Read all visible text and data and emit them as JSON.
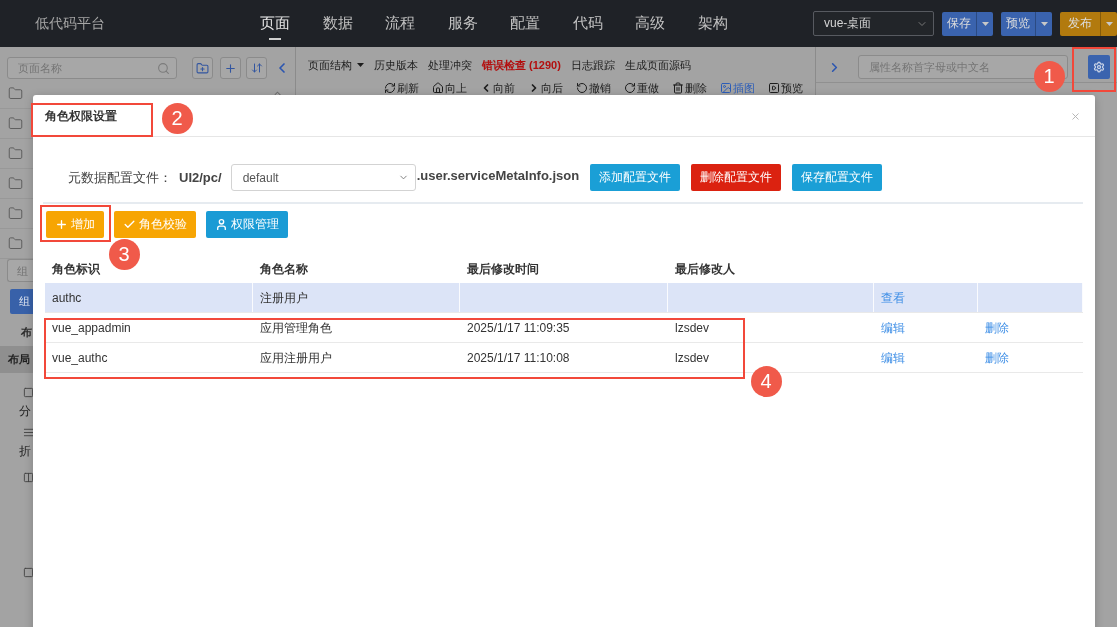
{
  "topbar": {
    "title": "低代码平台",
    "nav": [
      {
        "label": "页面",
        "selected": true
      },
      {
        "label": "数据",
        "selected": false
      },
      {
        "label": "流程",
        "selected": false
      },
      {
        "label": "服务",
        "selected": false
      },
      {
        "label": "配置",
        "selected": false
      },
      {
        "label": "代码",
        "selected": false
      },
      {
        "label": "高级",
        "selected": false
      },
      {
        "label": "架构",
        "selected": false
      }
    ],
    "project_select": {
      "value": "vue-桌面"
    },
    "buttons": [
      {
        "label": "保存",
        "kind": "primary"
      },
      {
        "label": "预览",
        "kind": "primary"
      },
      {
        "label": "发布",
        "kind": "warning"
      }
    ]
  },
  "page_panel": {
    "search": {
      "placeholder": "页面名称"
    }
  },
  "component_panel": {
    "search": {
      "placeholder": "组"
    },
    "tabs": [
      {
        "label": "组",
        "selected": true
      }
    ],
    "heading": "布",
    "category": "布局",
    "items": [
      {
        "label": "分"
      },
      {
        "label": "折"
      }
    ]
  },
  "editor_toolbar": {
    "menus": [
      {
        "label": "页面结构",
        "kind": "dropdown"
      },
      {
        "label": "历史版本",
        "kind": "plain"
      },
      {
        "label": "处理冲突",
        "kind": "plain"
      },
      {
        "label": "错误检查 (1290)",
        "kind": "error"
      },
      {
        "label": "日志跟踪",
        "kind": "plain"
      },
      {
        "label": "生成页面源码",
        "kind": "plain"
      }
    ],
    "actions": [
      {
        "label": "刷新",
        "kind": "refresh",
        "active": false
      },
      {
        "label": "向上",
        "kind": "up",
        "active": false
      },
      {
        "label": "向前",
        "kind": "back",
        "active": false
      },
      {
        "label": "向后",
        "kind": "forward",
        "active": false
      },
      {
        "label": "撤销",
        "kind": "undo",
        "active": false
      },
      {
        "label": "重做",
        "kind": "redo",
        "active": false
      },
      {
        "label": "删除",
        "kind": "delete",
        "active": false
      },
      {
        "label": "插图",
        "kind": "image",
        "active": true
      },
      {
        "label": "预览",
        "kind": "preview",
        "active": false
      }
    ]
  },
  "property_panel": {
    "search": {
      "placeholder": "属性名称首字母或中文名"
    }
  },
  "dialog": {
    "title": "角色权限设置",
    "config": {
      "label": "元数据配置文件：",
      "path_prefix": "UI2/pc/",
      "file_select": {
        "value": "default"
      },
      "suffix": ".user.serviceMetaInfo.json",
      "buttons": [
        {
          "label": "添加配置文件",
          "kind": "info"
        },
        {
          "label": "删除配置文件",
          "kind": "danger"
        },
        {
          "label": "保存配置文件",
          "kind": "info"
        }
      ]
    },
    "toolbar": [
      {
        "label": "增加",
        "kind": "add"
      },
      {
        "label": "角色校验",
        "kind": "check"
      },
      {
        "label": "权限管理",
        "kind": "permissions"
      }
    ],
    "table": {
      "columns": [
        "角色标识",
        "角色名称",
        "最后修改时间",
        "最后修改人"
      ],
      "rows": [
        {
          "role_id": "authc",
          "role_name": "注册用户",
          "selected": true,
          "actions": [
            "查看"
          ]
        },
        {
          "role_id": "vue_appadmin",
          "role_name": "应用管理角色",
          "modified_time": "2025/1/17 11:09:35",
          "modified_by": "lzsdev",
          "selected": false,
          "actions": [
            "编辑",
            "删除"
          ]
        },
        {
          "role_id": "vue_authc",
          "role_name": "应用注册用户",
          "modified_time": "2025/1/17 11:10:08",
          "modified_by": "lzsdev",
          "selected": false,
          "actions": [
            "编辑",
            "删除"
          ]
        }
      ]
    }
  },
  "annotations": [
    {
      "number": "1"
    },
    {
      "number": "2"
    },
    {
      "number": "3"
    },
    {
      "number": "4"
    }
  ]
}
